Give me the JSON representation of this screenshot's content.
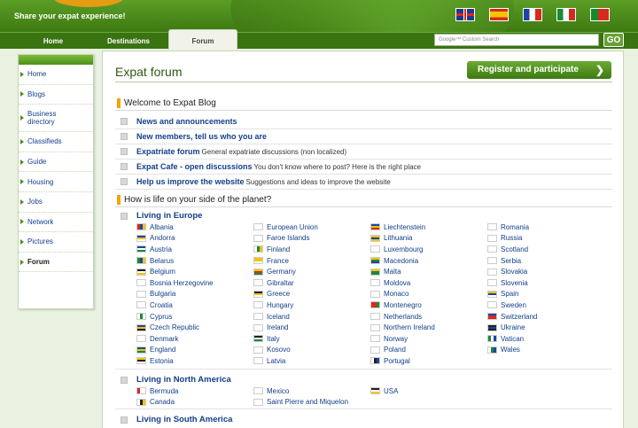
{
  "header": {
    "tagline": "Share your expat experience!",
    "language_flags": [
      {
        "name": "english-flag-icon",
        "color": "#1f3a8a"
      },
      {
        "name": "spanish-flag-icon",
        "color": "#d62a1e"
      },
      {
        "name": "french-flag-icon",
        "color": "#1c44a8"
      },
      {
        "name": "italian-flag-icon",
        "color": "#1a8a3a"
      },
      {
        "name": "portuguese-flag-icon",
        "color": "#138a2a"
      }
    ]
  },
  "nav": {
    "home": "Home",
    "destinations": "Destinations",
    "forum": "Forum",
    "search_placeholder": "Google™ Custom Search",
    "go": "GO"
  },
  "sidebar": {
    "items": [
      "Home",
      "Blogs",
      "Business directory",
      "Classifieds",
      "Guide",
      "Housing",
      "Jobs",
      "Network",
      "Pictures",
      "Forum"
    ]
  },
  "main": {
    "title": "Expat forum",
    "register_label": "Register and participate",
    "welcome_heading": "Welcome to Expat Blog",
    "forums": [
      {
        "title": "News and announcements",
        "desc": ""
      },
      {
        "title": "New members, tell us who you are",
        "desc": ""
      },
      {
        "title": "Expatriate forum",
        "desc": "General expatriate discussions (non localized)"
      },
      {
        "title": "Expat Cafe - open discussions",
        "desc": "You don't know where to post? Here is the right place"
      },
      {
        "title": "Help us improve the website",
        "desc": "Suggestions and ideas to improve the website"
      }
    ],
    "life_heading": "How is life on your side of the planet?",
    "regions": [
      {
        "title": "Living in Europe",
        "countries": [
          "Albania",
          "Andorra",
          "Austria",
          "Belarus",
          "Belgium",
          "Bosnia Herzegovine",
          "Bulgaria",
          "Croatia",
          "Cyprus",
          "Czech Republic",
          "Denmark",
          "England",
          "Estonia",
          "European Union",
          "Faroe Islands",
          "Finland",
          "France",
          "Germany",
          "Gibraltar",
          "Greece",
          "Hungary",
          "Iceland",
          "Ireland",
          "Italy",
          "Kosovo",
          "Latvia",
          "Liechtenstein",
          "Lithuania",
          "Luxembourg",
          "Macedonia",
          "Malta",
          "Moldova",
          "Monaco",
          "Montenegro",
          "Netherlands",
          "Northern Ireland",
          "Norway",
          "Poland",
          "Portugal",
          "Romania",
          "Russia",
          "Scotland",
          "Serbia",
          "Slovakia",
          "Slovenia",
          "Spain",
          "Sweden",
          "Switzerland",
          "Ukraine",
          "Vatican",
          "Wales"
        ]
      },
      {
        "title": "Living in North America",
        "countries": [
          "Bermuda",
          "Canada",
          "Mexico",
          "Saint Pierre and Miquelon",
          "USA"
        ]
      },
      {
        "title": "Living in South America",
        "countries": []
      }
    ]
  },
  "colors": {
    "brand_green": "#3d7a12",
    "link_blue": "#123f8a",
    "accent_orange": "#f5a400"
  }
}
